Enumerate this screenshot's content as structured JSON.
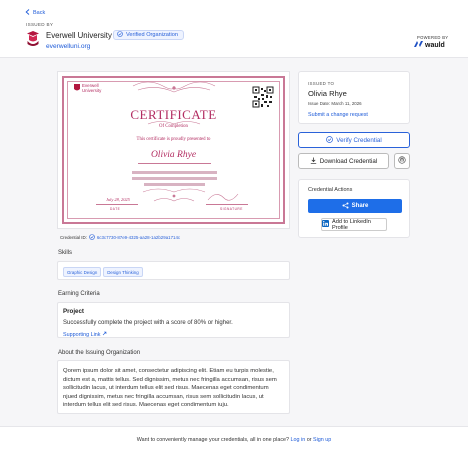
{
  "header": {
    "back_label": "Back",
    "issued_by_label": "ISSUED BY",
    "org_name": "Everwell University",
    "verified_badge": "Verified Organization",
    "org_link": "everwelluni.org",
    "powered_by_label": "POWERED BY",
    "powered_by_brand": "wauld"
  },
  "certificate": {
    "uni_line1": "Everwell",
    "uni_line2": "University",
    "title": "CERTIFICATE",
    "subtitle": "Of Completion",
    "presented_to": "This certificate is proudly presented to",
    "recipient": "Olivia Rhye",
    "date_value": "July 28, 2025",
    "date_label": "DATE",
    "signature_label": "SIGNATURE",
    "accent_color": "#b32d62"
  },
  "credential": {
    "id_label": "Credential ID:",
    "id_value": "6c3c7730-87e9-4325-aa28-1a2b29a1714c"
  },
  "skills": {
    "label": "Skills",
    "items": [
      "Graphic Design",
      "Design Thinking"
    ]
  },
  "earning": {
    "label": "Earning Criteria",
    "project_title": "Project",
    "project_text": "Successfully complete the project with a score of 80% or higher.",
    "supporting_link": "Supporting Link"
  },
  "about": {
    "label": "About the Issuing Organization",
    "text": "Qorem ipsum dolor sit amet, consectetur adipiscing elit. Etiam eu turpis molestie, dictum est a, mattis tellus. Sed dignissim, metus nec fringilla accumsan, risus sem sollicitudin lacus, ut interdum tellus elit sed risus. Maecenas eget condimentum njued dignissim, metus nec fringilla accumsan, risus sem sollicitudin lacus, ut interdum tellus elit sed risus. Maecenas eget condimentum iuju."
  },
  "sidebar": {
    "issued_to_label": "ISSUED TO",
    "recipient": "Olivia Rhye",
    "issue_date": "Issue Date: March 11, 2026",
    "change_request": "Submit a change request",
    "verify_label": "Verify Credential",
    "download_label": "Download Credential",
    "actions_title": "Credential Actions",
    "share_label": "Share",
    "linkedin_label": "Add to LinkedIn Profile"
  },
  "footer": {
    "prompt": "Want to conveniently manage your credentials, all in one place?",
    "login": "Log in",
    "or": "or",
    "signup": "Sign up"
  },
  "colors": {
    "primary": "#1e6ee8",
    "link": "#1e5bd8",
    "cert_accent": "#b32d62"
  }
}
